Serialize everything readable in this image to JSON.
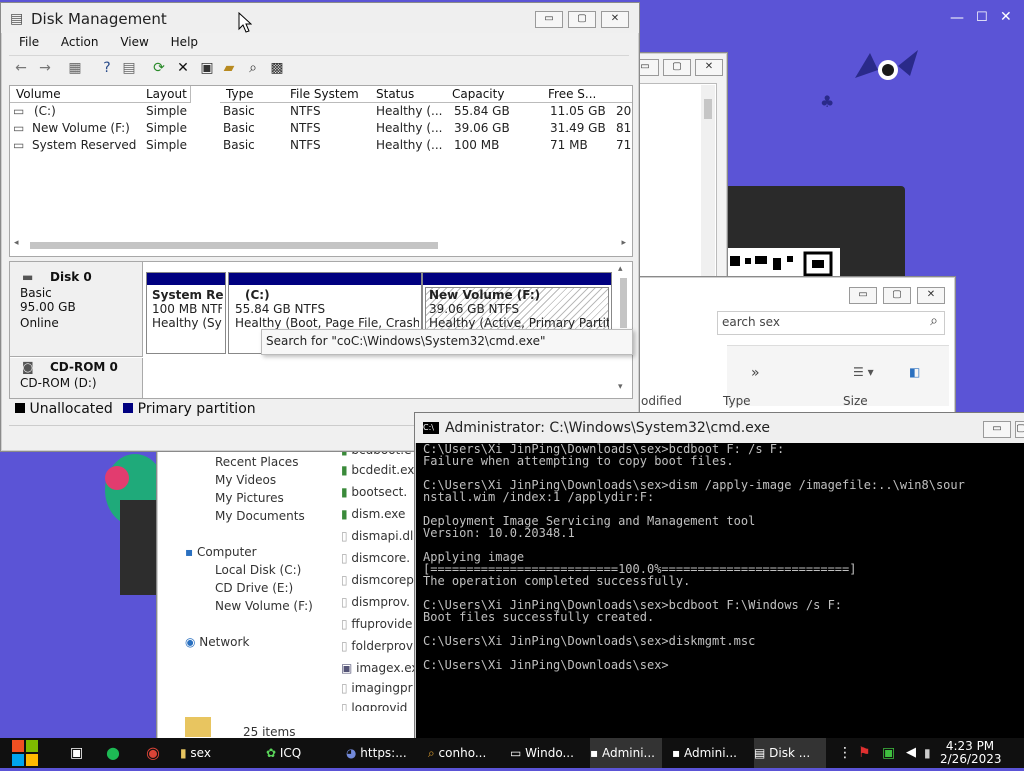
{
  "disk_mgmt": {
    "title": "Disk Management",
    "menu": [
      "File",
      "Action",
      "View",
      "Help"
    ],
    "columns": [
      "Volume",
      "Layout",
      "Type",
      "File System",
      "Status",
      "Capacity",
      "Free S...",
      "%"
    ],
    "rows": [
      {
        "volume": "(C:)",
        "layout": "Simple",
        "type": "Basic",
        "fs": "NTFS",
        "status": "Healthy (...",
        "capacity": "55.84 GB",
        "free": "11.05 GB",
        "pct": "20"
      },
      {
        "volume": "New Volume (F:)",
        "layout": "Simple",
        "type": "Basic",
        "fs": "NTFS",
        "status": "Healthy (...",
        "capacity": "39.06 GB",
        "free": "31.49 GB",
        "pct": "81"
      },
      {
        "volume": "System Reserved",
        "layout": "Simple",
        "type": "Basic",
        "fs": "NTFS",
        "status": "Healthy (...",
        "capacity": "100 MB",
        "free": "71 MB",
        "pct": "71"
      }
    ],
    "disk0": {
      "name": "Disk 0",
      "type": "Basic",
      "size": "95.00 GB",
      "state": "Online"
    },
    "partitions": [
      {
        "name": "System Re",
        "detail": "100 MB NTF",
        "status": "Healthy (Sys"
      },
      {
        "name": "(C:)",
        "detail": "55.84 GB NTFS",
        "status": "Healthy (Boot, Page File, Crash I"
      },
      {
        "name": "New Volume  (F:)",
        "detail": "39.06 GB NTFS",
        "status": "Healthy (Active, Primary Partitio"
      }
    ],
    "cdrom": {
      "name": "CD-ROM 0",
      "drive": "CD-ROM (D:)"
    },
    "legend": [
      "Unallocated",
      "Primary partition"
    ],
    "tooltip": "Search for \"coC:\\Windows\\System32\\cmd.exe\""
  },
  "explorer": {
    "search_placeholder": "earch sex",
    "col_modified": "odified",
    "col_type": "Type",
    "col_size": "Size",
    "nav_arrows": "»",
    "sidebar": [
      "Recent Places",
      "My Videos",
      "My Pictures",
      "My Documents",
      "Computer",
      "Local Disk (C:)",
      "CD Drive (E:)",
      "New Volume (F:)",
      "Network"
    ],
    "files": [
      "bcdboot.e",
      "bcdedit.ex",
      "bootsect.",
      "dism.exe",
      "dismapi.dl",
      "dismcore.",
      "dismcorep",
      "dismprov.",
      "ffuprovide",
      "folderprov",
      "imagex.ex",
      "imagingpr",
      "logprovid"
    ],
    "item_count": "25 items"
  },
  "cmd": {
    "title": "Administrator: C:\\Windows\\System32\\cmd.exe",
    "lines": [
      "C:\\Users\\Xi JinPing\\Downloads\\sex>bcdboot F: /s F:",
      "Failure when attempting to copy boot files.",
      "",
      "C:\\Users\\Xi JinPing\\Downloads\\sex>dism /apply-image /imagefile:..\\win8\\sour",
      "nstall.wim /index:1 /applydir:F:",
      "",
      "Deployment Image Servicing and Management tool",
      "Version: 10.0.20348.1",
      "",
      "Applying image",
      "[==========================100.0%==========================]",
      "The operation completed successfully.",
      "",
      "C:\\Users\\Xi JinPing\\Downloads\\sex>bcdboot F:\\Windows /s F:",
      "Boot files successfully created.",
      "",
      "C:\\Users\\Xi JinPing\\Downloads\\sex>diskmgmt.msc",
      "",
      "C:\\Users\\Xi JinPing\\Downloads\\sex>"
    ]
  },
  "taskbar": {
    "items": [
      "sex",
      "ICQ",
      "https:...",
      "conho...",
      "Windo...",
      "Admini...",
      "Admini...",
      "Disk ..."
    ],
    "time": "4:23 PM",
    "date": "2/26/2023"
  },
  "colors": {
    "desktop": "#5b54d6",
    "partition_bar": "#000080",
    "cmd_bg": "#000000",
    "cmd_fg": "#c0c0c0",
    "taskbar": "#101010"
  }
}
